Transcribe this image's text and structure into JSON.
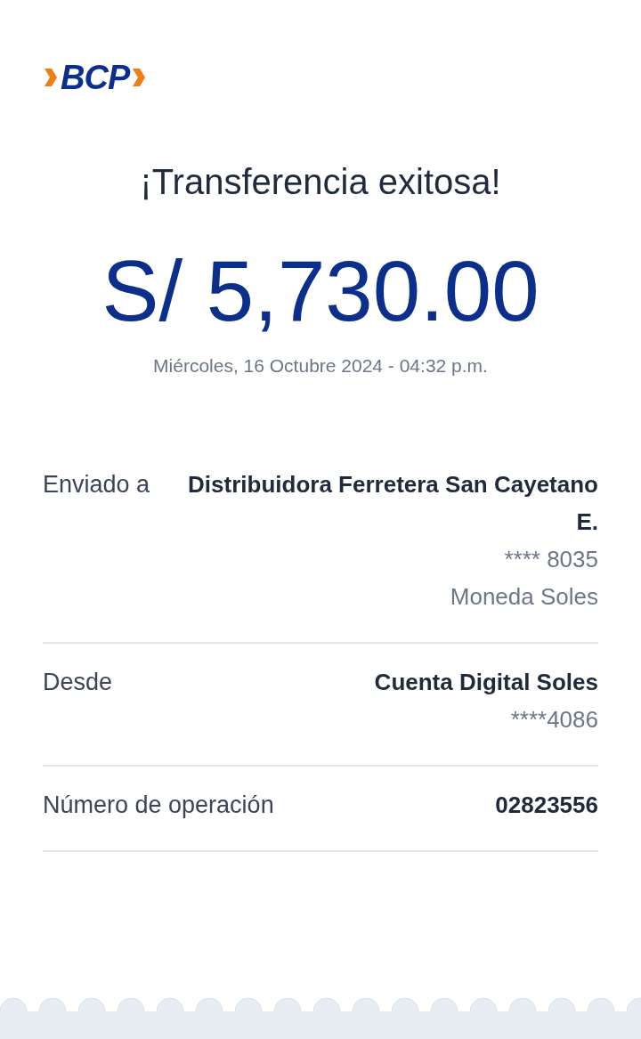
{
  "brand": {
    "logo_text": "BCP"
  },
  "title": "¡Transferencia exitosa!",
  "amount": "S/ 5,730.00",
  "datetime": "Miércoles, 16 Octubre 2024 - 04:32 p.m.",
  "details": [
    {
      "label": "Enviado a",
      "values": [
        {
          "text": "Distribuidora Ferretera San Cayetano E.",
          "kind": "strong"
        },
        {
          "text": "**** 8035",
          "kind": "muted"
        },
        {
          "text": "Moneda Soles",
          "kind": "muted"
        }
      ]
    },
    {
      "label": "Desde",
      "values": [
        {
          "text": "Cuenta Digital Soles",
          "kind": "strong"
        },
        {
          "text": "****4086",
          "kind": "muted"
        }
      ]
    },
    {
      "label": "Número de operación",
      "values": [
        {
          "text": "02823556",
          "kind": "strong"
        }
      ]
    }
  ]
}
